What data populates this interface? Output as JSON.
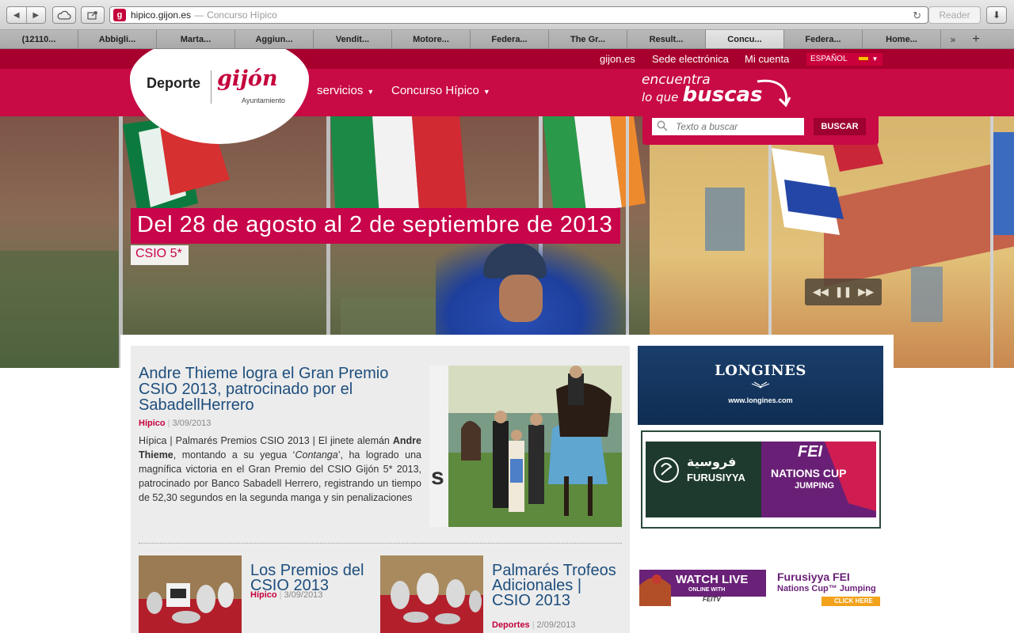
{
  "browser": {
    "url_host": "hipico.gijon.es",
    "url_sep": "—",
    "url_title": "Concurso Hípico",
    "reader_label": "Reader",
    "tabs": [
      {
        "label": "(12110..."
      },
      {
        "label": "Abbigli..."
      },
      {
        "label": "Marta..."
      },
      {
        "label": "Aggiun..."
      },
      {
        "label": "Vendit..."
      },
      {
        "label": "Motore..."
      },
      {
        "label": "Federa..."
      },
      {
        "label": "The Gr..."
      },
      {
        "label": "Result..."
      },
      {
        "label": "Concu..."
      },
      {
        "label": "Federa..."
      },
      {
        "label": "Home..."
      }
    ],
    "tab_more": "»",
    "tab_add": "+"
  },
  "topbar": {
    "links": [
      "gijon.es",
      "Sede electrónica",
      "Mi cuenta"
    ],
    "language": "ESPAÑOL"
  },
  "logo": {
    "deporte": "Deporte",
    "gijon": "gijón",
    "ayuntamiento": "Ayuntamiento"
  },
  "nav": {
    "servicios": "servicios",
    "concurso": "Concurso Hípico"
  },
  "slogan": {
    "line1": "encuentra",
    "line2a": "lo que",
    "line2b": "buscas"
  },
  "search": {
    "placeholder": "Texto a buscar",
    "button": "BUSCAR"
  },
  "hero": {
    "date": "Del 28 de agosto al 2 de septiembre de 2013",
    "event": "CSIO 5*"
  },
  "main_news": {
    "title": "Andre Thieme logra el Gran Premio CSIO 2013, patrocinado por el SabadellHerrero",
    "category": "Hípico",
    "date": "3/09/2013",
    "body_1": "Hípica | Palmarés Premios CSIO 2013 | El jinete alemán ",
    "body_bold": "Andre Thieme",
    "body_2": ", montando a su yegua ‘",
    "body_italic": "Contanga",
    "body_3": "’, ha logrado una magnífica victoria en el Gran Premio del CSIO Gijón 5* 2013, patrocinado por Banco Sabadell Herrero, registrando un tiempo de 52,30 segundos en la segunda manga y sin penalizaciones"
  },
  "news_items": [
    {
      "title": "Los Premios del CSIO 2013",
      "category": "Hípico",
      "date": "3/09/2013"
    },
    {
      "title": "Palmarés Trofeos Adicionales | CSIO 2013",
      "category": "Deportes",
      "date": "2/09/2013"
    }
  ],
  "ads": {
    "longines_brand": "LONGINES",
    "longines_url": "www.longines.com",
    "furusiyya_ar": "فروسية",
    "furusiyya": "FURUSIYYA",
    "fei": "FEI",
    "nations_cup": "NATIONS CUP",
    "jumping": "JUMPING",
    "watch_live": "WATCH LIVE",
    "online_with": "ONLINE WITH",
    "feitv": "FEITV",
    "furusiyya_fei": "Furusiyya FEI",
    "nations_cup_jumping": "Nations Cup™ Jumping",
    "click_here": "CLICK HERE"
  }
}
